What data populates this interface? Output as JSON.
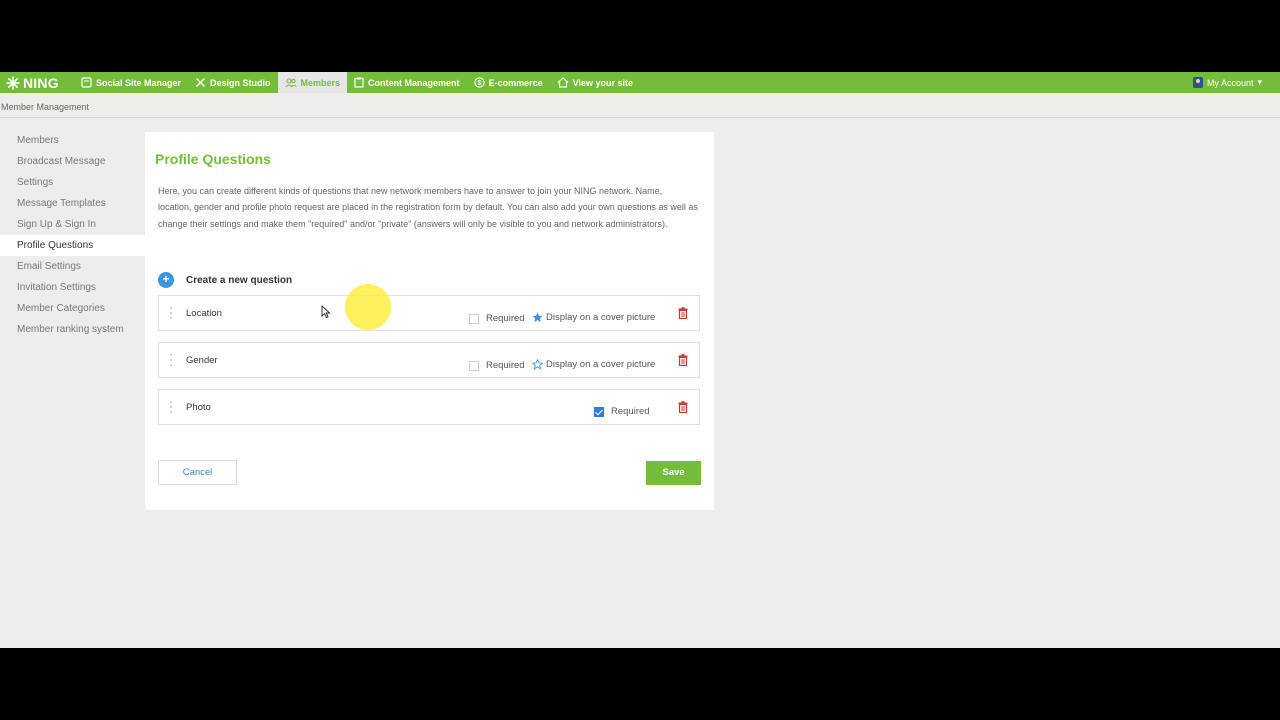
{
  "brand": {
    "name": "NING"
  },
  "nav": {
    "items": [
      {
        "label": "Social Site Manager",
        "icon": "site-manager-icon"
      },
      {
        "label": "Design Studio",
        "icon": "design-icon"
      },
      {
        "label": "Members",
        "icon": "members-icon",
        "active": true
      },
      {
        "label": "Content Management",
        "icon": "content-icon"
      },
      {
        "label": "E-commerce",
        "icon": "dollar-icon"
      },
      {
        "label": "View your site",
        "icon": "home-icon"
      }
    ],
    "account_label": "My Account"
  },
  "breadcrumb": "Member Management",
  "sidebar": {
    "items": [
      {
        "label": "Members"
      },
      {
        "label": "Broadcast Message"
      },
      {
        "label": "Settings"
      },
      {
        "label": "Message Templates"
      },
      {
        "label": "Sign Up & Sign In"
      },
      {
        "label": "Profile Questions",
        "active": true
      },
      {
        "label": "Email Settings"
      },
      {
        "label": "Invitation Settings"
      },
      {
        "label": "Member Categories"
      },
      {
        "label": "Member ranking system"
      }
    ]
  },
  "main": {
    "title": "Profile Questions",
    "description": "Here, you can create different kinds of questions that new network members have to answer to join your NING network. Name, location, gender and profile photo request are placed in the registration form by default. You can also add your own questions as well as change their settings and make them \"required\" and/or \"private\" (answers will only be visible to you and network administrators).",
    "create_label": "Create a new question",
    "questions": [
      {
        "label": "Location",
        "required_label": "Required",
        "required": false,
        "cover_label": "Display on a cover picture",
        "cover": true
      },
      {
        "label": "Gender",
        "required_label": "Required",
        "required": false,
        "cover_label": "Display on a cover picture",
        "cover": false
      },
      {
        "label": "Photo",
        "required_label": "Required",
        "required": true
      }
    ],
    "cancel_label": "Cancel",
    "save_label": "Save"
  },
  "colors": {
    "brand_green": "#74bd3b",
    "accent_blue": "#3b95e0",
    "delete_red": "#c0392b"
  }
}
